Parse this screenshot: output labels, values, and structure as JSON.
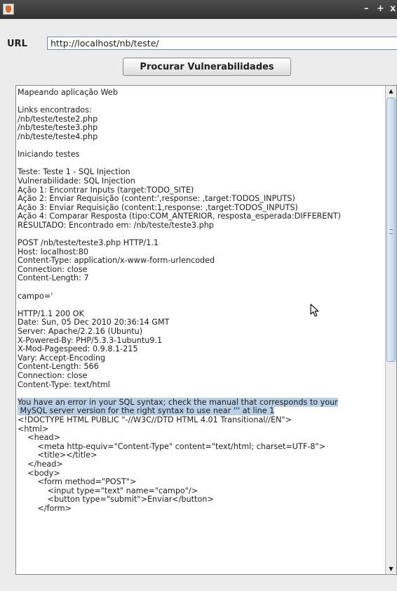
{
  "window": {
    "title_buttons": {
      "minimize": "–",
      "maximize": "+",
      "close": "x"
    }
  },
  "url": {
    "label": "URL",
    "value": "http://localhost/nb/teste/"
  },
  "scan_button": {
    "label": "Procurar Vulnerabilidades"
  },
  "output": {
    "lines": [
      "Mapeando aplicação Web",
      "",
      "Links encontrados:",
      "/nb/teste/teste2.php",
      "/nb/teste/teste3.php",
      "/nb/teste/teste4.php",
      "",
      "Iniciando testes",
      "",
      "Teste: Teste 1 - SQL Injection",
      "Vulnerabilidade: SQL Injection",
      "Ação 1: Encontrar Inputs (target:TODO_SITE)",
      "Ação 2: Enviar Requisição (content:',response: ,target:TODOS_INPUTS)",
      "Ação 3: Enviar Requisição (content:1,response: ,target:TODOS_INPUTS)",
      "Ação 4: Comparar Resposta (tipo:COM_ANTERIOR, resposta_esperada:DIFFERENT)",
      "RESULTADO: Encontrado em: /nb/teste/teste3.php",
      "",
      "POST /nb/teste/teste3.php HTTP/1.1",
      "Host: localhost:80",
      "Content-Type: application/x-www-form-urlencoded",
      "Connection: close",
      "Content-Length: 7",
      "",
      "campo='",
      "",
      "HTTP/1.1 200 OK",
      "Date: Sun, 05 Dec 2010 20:36:14 GMT",
      "Server: Apache/2.2.16 (Ubuntu)",
      "X-Powered-By: PHP/5.3.3-1ubuntu9.1",
      "X-Mod-Pagespeed: 0.9.8.1-215",
      "Vary: Accept-Encoding",
      "Content-Length: 566",
      "Connection: close",
      "Content-Type: text/html",
      "",
      "You have an error in your SQL syntax; check the manual that corresponds to your",
      " MySQL server version for the right syntax to use near ''' at line 1",
      "<!DOCTYPE HTML PUBLIC \"-//W3C//DTD HTML 4.01 Transitional//EN\">",
      "<html>",
      "    <head>",
      "        <meta http-equiv=\"Content-Type\" content=\"text/html; charset=UTF-8\">",
      "        <title></title>",
      "    </head>",
      "    <body>",
      "        <form method=\"POST\">",
      "            <input type=\"text\" name=\"campo\"/>",
      "            <button type=\"submit\">Enviar</button>",
      "        </form>"
    ],
    "highlighted_lines": [
      35,
      36
    ]
  },
  "scrollbar": {
    "up_arrow": "▲",
    "down_arrow": "▼",
    "scroll_position": 0.0
  },
  "colors": {
    "titlebar": "#3d3d3d",
    "window_bg": "#ececec",
    "selection": "#b8cfe5",
    "scroll_thumb": "#bfd2ea"
  }
}
